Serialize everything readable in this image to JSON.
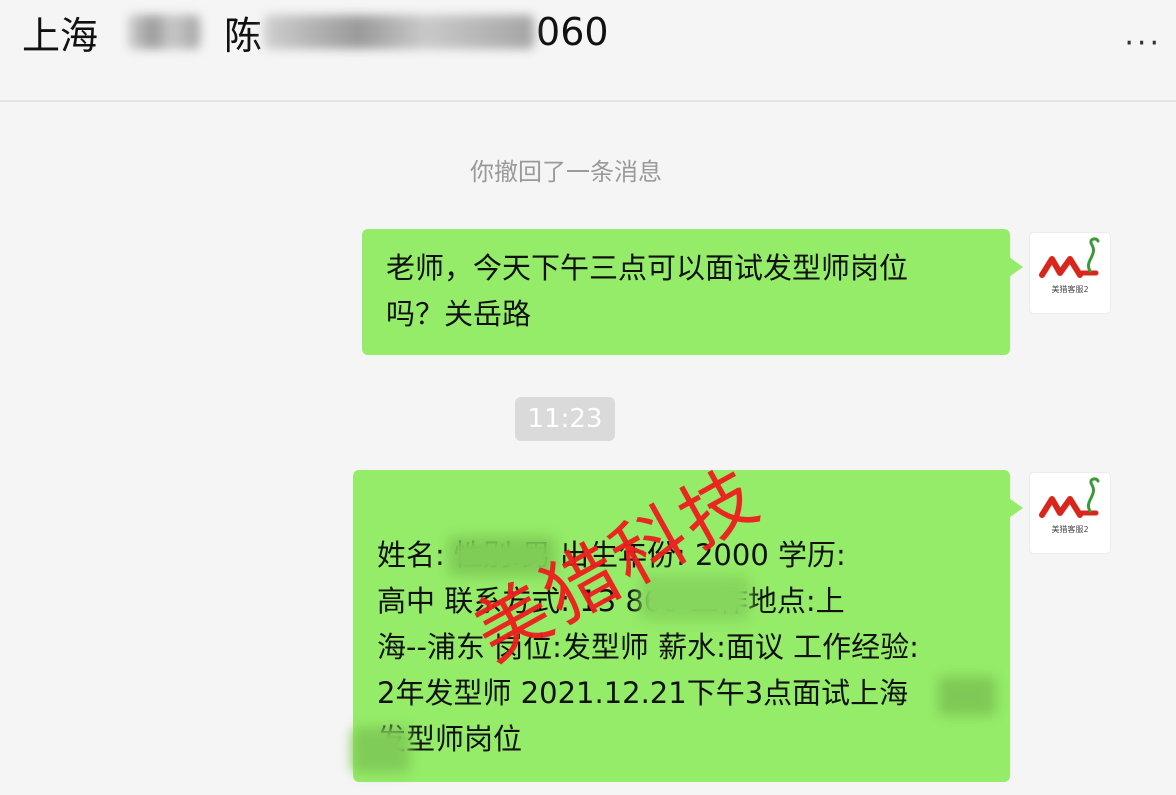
{
  "header": {
    "title_prefix": "上海",
    "title_mid": "陈",
    "title_suffix": "060",
    "more_icon": "more-dots-icon",
    "more_glyph": "···"
  },
  "chat": {
    "recall_notice": "你撤回了一条消息",
    "time": "11:23",
    "messages": [
      {
        "lines": [
          " 老师，今天下午三点可以面试发型师岗位",
          "吗？关岳路"
        ]
      },
      {
        "lines": [
          "姓名:         性别:男 出生年份: 2000 学历:",
          "高中 联系方式: 13          869 工作地点:上",
          "海--浦东 岗位:发型师 薪水:面议 工作经验:",
          "2年发型师 2021.12.21下午3点面试上海",
          "      发型师岗位"
        ]
      }
    ]
  },
  "avatar": {
    "caption": "美猎客服2",
    "icon": "brand-logo-icon",
    "brand_color": "#d9261c"
  },
  "watermark": "美猎科技",
  "colors": {
    "bubble": "#95ec69",
    "background": "#f5f5f5",
    "watermark": "#ee1d1d"
  }
}
